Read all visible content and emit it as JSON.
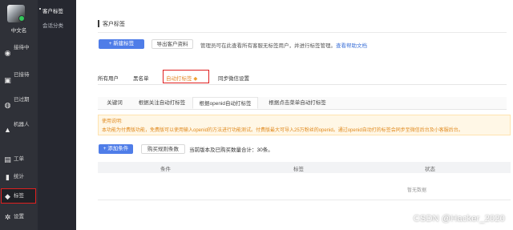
{
  "rail": {
    "nickname": "中文名",
    "items": [
      {
        "label": "接待中",
        "icon": "eye-icon"
      },
      {
        "label": "已接待",
        "icon": "chat-bubble-icon"
      },
      {
        "label": "已过期",
        "icon": "clock-chat-icon"
      },
      {
        "label": "机器人",
        "icon": "robot-icon"
      },
      {
        "label": "工单",
        "icon": "ticket-icon"
      },
      {
        "label": "统计",
        "icon": "bar-chart-icon"
      },
      {
        "label": "标签",
        "icon": "tag-icon"
      },
      {
        "label": "设置",
        "icon": "gear-icon"
      }
    ]
  },
  "subnav": {
    "items": [
      {
        "label": "客户标签"
      },
      {
        "label": "会话分类"
      }
    ]
  },
  "main": {
    "title": "客户标签",
    "buttons": {
      "new_tag": "+ 新建标签",
      "export": "导出客户资料"
    },
    "tip": "管理员可在此查看所有客服无标签用户，并进行标签管理。",
    "tip_link": "查看帮助文档",
    "tabs": [
      "所有用户",
      "黑名单",
      "自动打标签",
      "同步微信设置"
    ],
    "active_tab_badge": "◆",
    "subtabs": [
      "关键词",
      "根据关注自动打标签",
      "根据openid自动打标签",
      "根据点击菜单自动打标签"
    ],
    "notice": {
      "title": "使用说明:",
      "text": "本功能为付费版功能，免费版可以使用输入openid的方法进行功能测试。付费版最大可导入25万粉丝的openid。通过openid自动打的标签会同步至微信后台及小客服后台。"
    },
    "actions": {
      "add_condition": "+ 添加条件",
      "buy_rules": "购买规则条数"
    },
    "count_text": "当前版本及已购买数量合计：30条。",
    "table": {
      "headers": [
        "条件",
        "标签",
        "状态"
      ],
      "empty": "暂无数据"
    }
  },
  "watermark": "CSDN @Hacker_2020"
}
